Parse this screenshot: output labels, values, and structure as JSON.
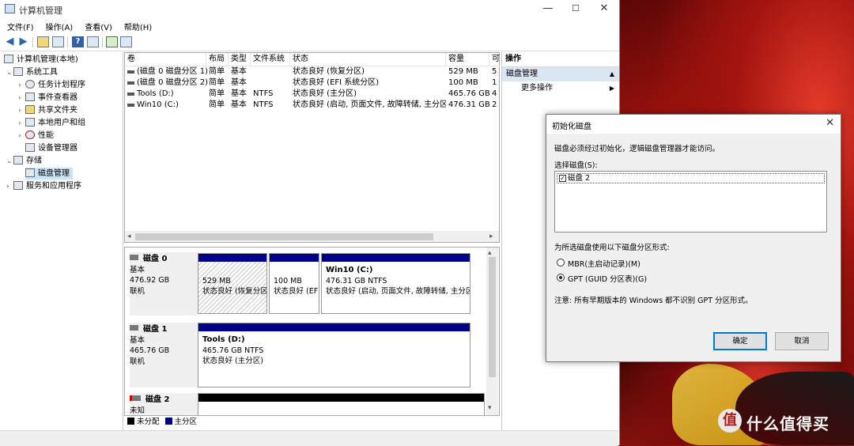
{
  "window": {
    "title": "计算机管理",
    "controls": {
      "minimize": "—",
      "maximize": "☐",
      "close": "✕"
    }
  },
  "menu": [
    "文件(F)",
    "操作(A)",
    "查看(V)",
    "帮助(H)"
  ],
  "tree": {
    "root": "计算机管理(本地)",
    "system_tools": "系统工具",
    "task_scheduler": "任务计划程序",
    "event_viewer": "事件查看器",
    "shared_folders": "共享文件夹",
    "local_users": "本地用户和组",
    "performance": "性能",
    "device_manager": "设备管理器",
    "storage": "存储",
    "disk_management": "磁盘管理",
    "services": "服务和应用程序"
  },
  "volume_list": {
    "columns": [
      "卷",
      "布局",
      "类型",
      "文件系统",
      "状态",
      "容量",
      "可"
    ],
    "rows": [
      [
        "(磁盘 0 磁盘分区 1)",
        "简单",
        "基本",
        "",
        "状态良好 (恢复分区)",
        "529 MB",
        "5"
      ],
      [
        "(磁盘 0 磁盘分区 2)",
        "简单",
        "基本",
        "",
        "状态良好 (EFI 系统分区)",
        "100 MB",
        "1"
      ],
      [
        "Tools (D:)",
        "简单",
        "基本",
        "NTFS",
        "状态良好 (主分区)",
        "465.76 GB",
        "4"
      ],
      [
        "Win10 (C:)",
        "简单",
        "基本",
        "NTFS",
        "状态良好 (启动, 页面文件, 故障转储, 主分区)",
        "476.31 GB",
        "2"
      ]
    ]
  },
  "disks": [
    {
      "name": "磁盘 0",
      "type": "基本",
      "size": "476.92 GB",
      "status": "联机",
      "partitions": [
        {
          "title": "",
          "size": "529 MB",
          "status": "状态良好 (恢复分区)"
        },
        {
          "title": "",
          "size": "100 MB",
          "status": "状态良好 (EFI 系统分区)"
        },
        {
          "title": "Win10  (C:)",
          "size": "476.31 GB NTFS",
          "status": "状态良好 (启动, 页面文件, 故障转储, 主分区)"
        }
      ]
    },
    {
      "name": "磁盘 1",
      "type": "基本",
      "size": "465.76 GB",
      "status": "联机",
      "partitions": [
        {
          "title": "Tools  (D:)",
          "size": "465.76 GB NTFS",
          "status": "状态良好 (主分区)"
        }
      ]
    },
    {
      "name": "磁盘 2",
      "type": "未知",
      "size": "",
      "status": ""
    }
  ],
  "legend": {
    "unallocated": "未分配",
    "primary": "主分区",
    "unallocated_color": "#000000",
    "primary_color": "#00008b"
  },
  "actions": {
    "header": "操作",
    "section": "磁盘管理",
    "more": "更多操作"
  },
  "dialog": {
    "title": "初始化磁盘",
    "intro": "磁盘必须经过初始化，逻辑磁盘管理器才能访问。",
    "select_label": "选择磁盘(S):",
    "disk_item": "磁盘 2",
    "style_label": "为所选磁盘使用以下磁盘分区形式:",
    "mbr": "MBR(主启动记录)(M)",
    "gpt": "GPT (GUID 分区表)(G)",
    "selected_style": "GPT",
    "note": "注意: 所有早期版本的 Windows 都不识别 GPT 分区形式。",
    "ok": "确定",
    "cancel": "取消"
  },
  "wallpaper": {
    "logo_text": "值",
    "brand": "什么值得买"
  },
  "colors": {
    "selection": "#cce4f7",
    "primary_partition": "#00008b",
    "action_section": "#dbe6f3"
  }
}
